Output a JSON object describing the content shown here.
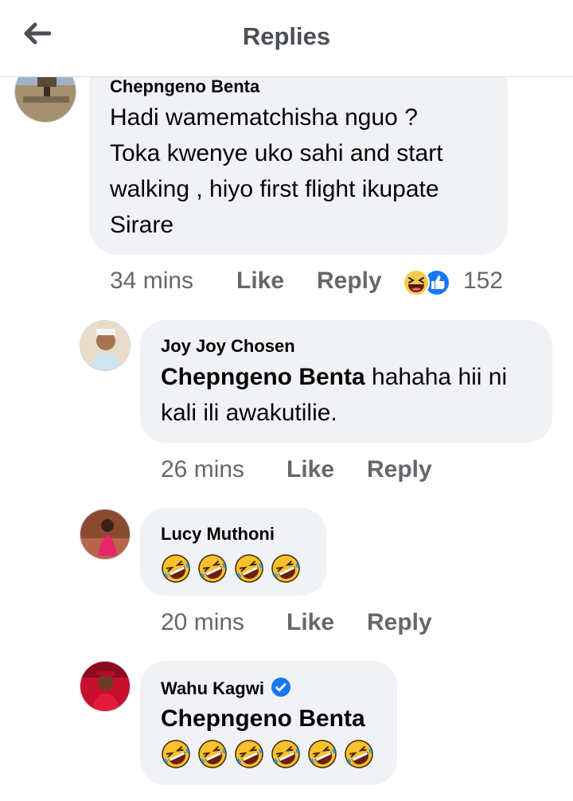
{
  "header": {
    "title": "Replies",
    "back_icon": "arrow-left-icon"
  },
  "comments": [
    {
      "author": "Chepngeno Benta",
      "lines": [
        "Hadi wamematchisha nguo ?",
        "Toka kwenye uko sahi and start",
        "walking , hiyo first flight ikupate",
        "Sirare"
      ],
      "time": "34 mins",
      "like_label": "Like",
      "reply_label": "Reply",
      "reactions": [
        "haha-reaction-icon",
        "like-reaction-icon"
      ],
      "reaction_count": "152"
    },
    {
      "author": "Joy Joy Chosen",
      "mention": "Chepngeno Benta",
      "line1_rest": " hahaha hii ni",
      "line2": "kali ili awakutilie.",
      "time": "26 mins",
      "like_label": "Like",
      "reply_label": "Reply"
    },
    {
      "author": "Lucy Muthoni",
      "emoji": "rolling-on-floor-laughing-emoji",
      "emoji_count": 4,
      "time": "20 mins",
      "like_label": "Like",
      "reply_label": "Reply"
    },
    {
      "author": "Wahu Kagwi",
      "verified": true,
      "mention": "Chepngeno Benta",
      "emoji": "rolling-on-floor-laughing-emoji",
      "emoji_count": 6
    }
  ],
  "colors": {
    "bubble": "#f0f2f5",
    "text": "#050505",
    "secondary": "#65676b",
    "verified": "#1877f2"
  }
}
